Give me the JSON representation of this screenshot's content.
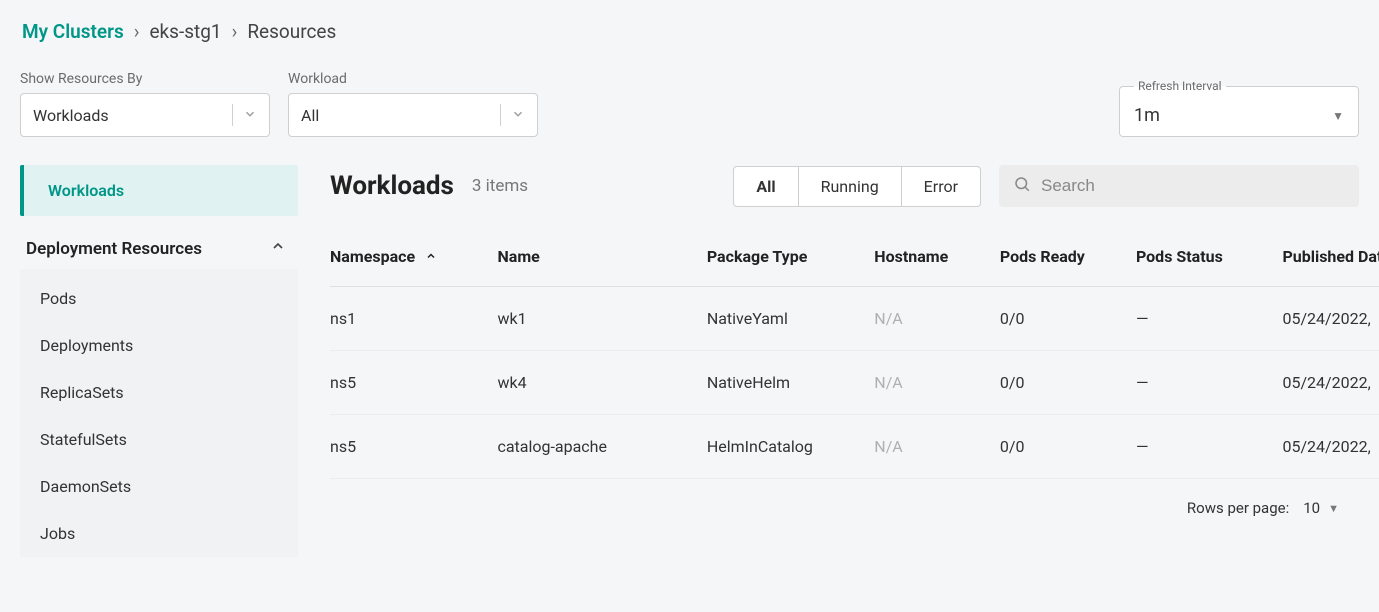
{
  "breadcrumb": {
    "root": "My Clusters",
    "cluster": "eks-stg1",
    "current": "Resources"
  },
  "filters": {
    "showResourcesBy": {
      "label": "Show Resources By",
      "value": "Workloads"
    },
    "workload": {
      "label": "Workload",
      "value": "All"
    },
    "refresh": {
      "label": "Refresh Interval",
      "value": "1m"
    }
  },
  "sidebar": {
    "top": [
      {
        "label": "Workloads",
        "active": true
      }
    ],
    "section": {
      "title": "Deployment Resources",
      "items": [
        {
          "label": "Pods"
        },
        {
          "label": "Deployments"
        },
        {
          "label": "ReplicaSets"
        },
        {
          "label": "StatefulSets"
        },
        {
          "label": "DaemonSets"
        },
        {
          "label": "Jobs"
        }
      ]
    }
  },
  "main": {
    "title": "Workloads",
    "count": "3 items",
    "tabs": {
      "all": "All",
      "running": "Running",
      "error": "Error"
    },
    "search_placeholder": "Search"
  },
  "table": {
    "headers": {
      "namespace": "Namespace",
      "name": "Name",
      "packageType": "Package Type",
      "hostname": "Hostname",
      "podsReady": "Pods Ready",
      "podsStatus": "Pods Status",
      "publishedDate": "Published Date"
    },
    "rows": [
      {
        "namespace": "ns1",
        "name": "wk1",
        "packageType": "NativeYaml",
        "hostname": "N/A",
        "podsReady": "0/0",
        "podsStatus": "—",
        "publishedDate": "05/24/2022,"
      },
      {
        "namespace": "ns5",
        "name": "wk4",
        "packageType": "NativeHelm",
        "hostname": "N/A",
        "podsReady": "0/0",
        "podsStatus": "—",
        "publishedDate": "05/24/2022,"
      },
      {
        "namespace": "ns5",
        "name": "catalog-apache",
        "packageType": "HelmInCatalog",
        "hostname": "N/A",
        "podsReady": "0/0",
        "podsStatus": "—",
        "publishedDate": "05/24/2022,"
      }
    ],
    "footer": {
      "rowsLabel": "Rows per page:",
      "rowsValue": "10"
    }
  }
}
